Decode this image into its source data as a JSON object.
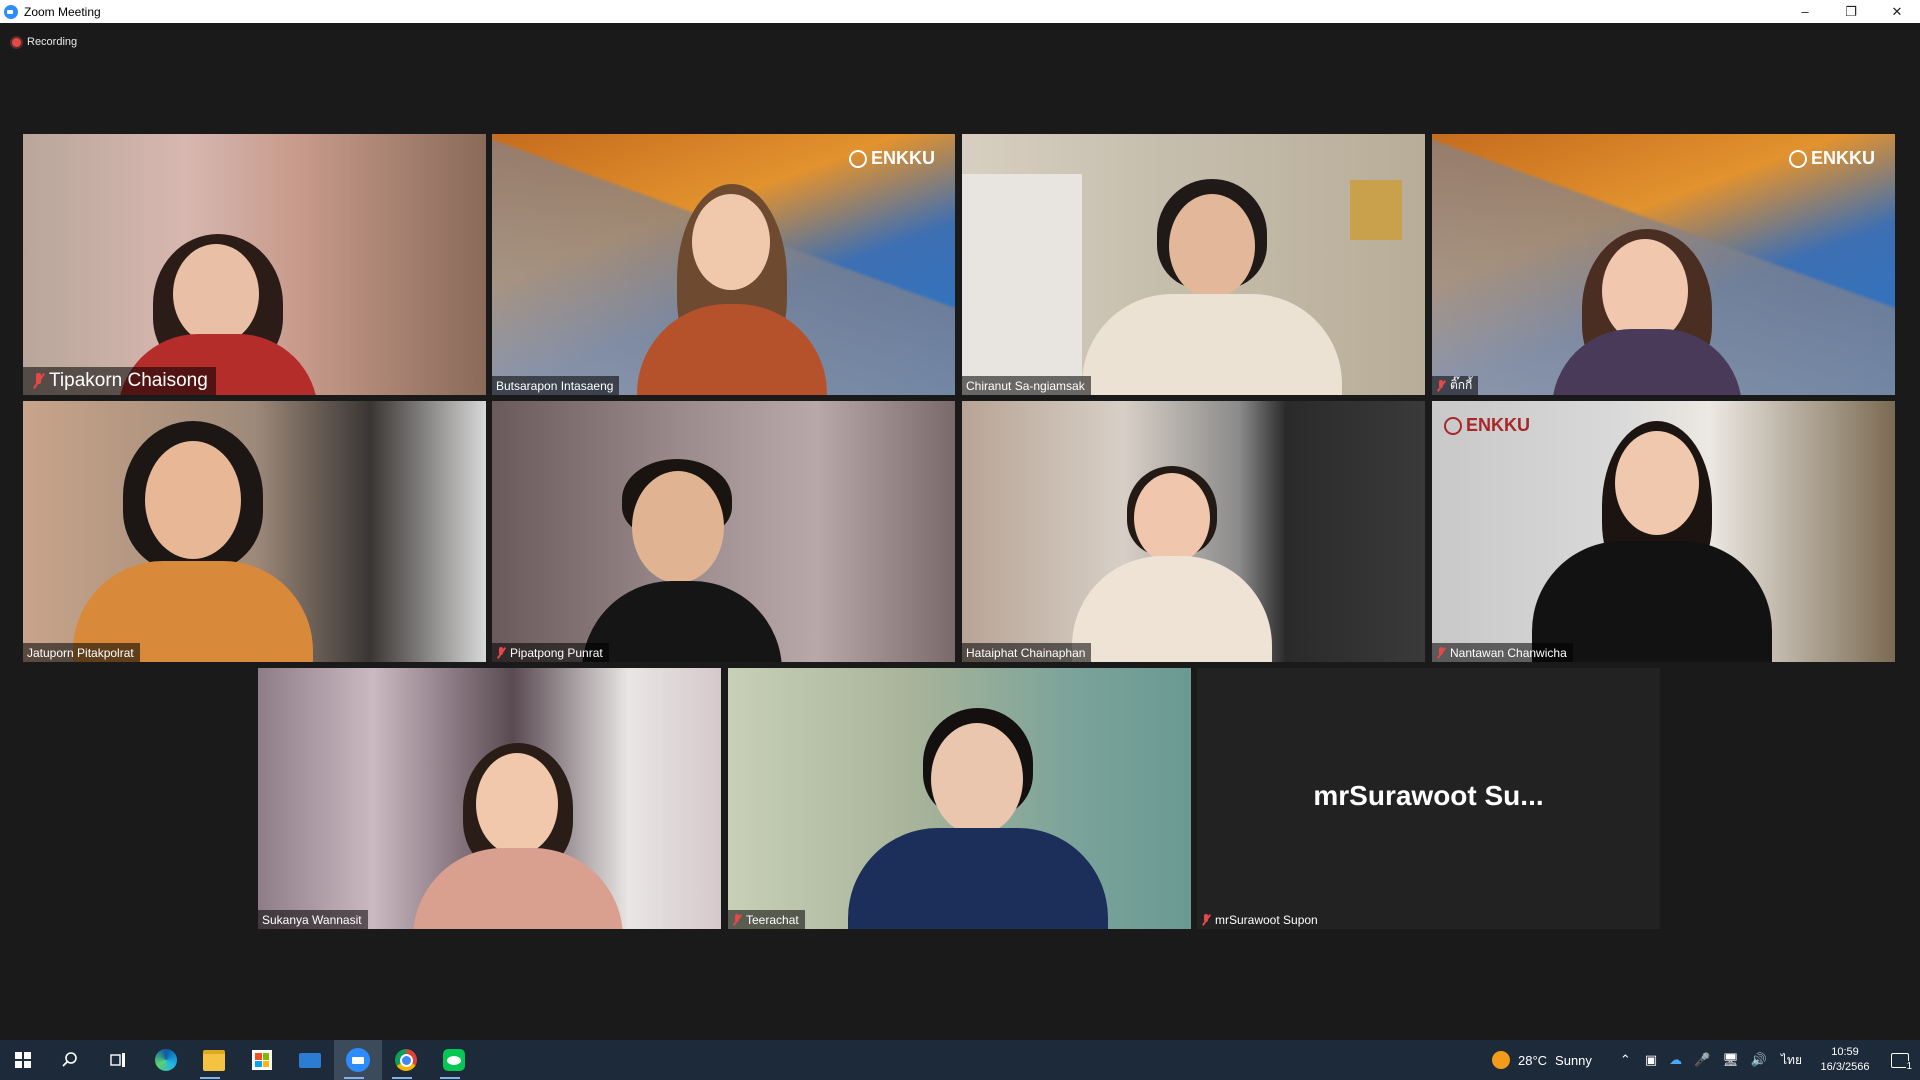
{
  "window": {
    "title": "Zoom Meeting"
  },
  "recording": {
    "label": "Recording"
  },
  "participants": [
    {
      "name": "Tipakorn Chaisong",
      "muted": true,
      "pinned": true
    },
    {
      "name": "Butsarapon Intasaeng",
      "muted": false,
      "active_speaker": true,
      "background_logo": "ENKKU"
    },
    {
      "name": "Chiranut Sa-ngiamsak",
      "muted": false
    },
    {
      "name": "ติ๊กกี้",
      "muted": true,
      "background_logo": "ENKKU"
    },
    {
      "name": "Jatuporn Pitakpolrat",
      "muted": false
    },
    {
      "name": "Pipatpong Punrat",
      "muted": true
    },
    {
      "name": "Hataiphat Chainaphan",
      "muted": false
    },
    {
      "name": "Nantawan Chanwicha",
      "muted": true,
      "background_logo": "ENKKU"
    },
    {
      "name": "Sukanya Wannasit",
      "muted": false
    },
    {
      "name": "Teerachat",
      "muted": true
    },
    {
      "name": "mrSurawoot Supon",
      "muted": true,
      "video_off": true,
      "display_name": "mrSurawoot  Su..."
    }
  ],
  "taskbar": {
    "apps": [
      "windows-start",
      "search",
      "task-view",
      "edge",
      "file-explorer",
      "microsoft-store",
      "mail",
      "zoom",
      "chrome",
      "line"
    ],
    "weather": {
      "temp": "28°C",
      "condition": "Sunny"
    },
    "language": "ไทย",
    "time": "10:59",
    "date": "16/3/2566",
    "notifications": "1"
  },
  "colors": {
    "active_speaker_border": "#d9e25a",
    "background": "#1a1a1a",
    "muted_icon": "#e64848"
  }
}
